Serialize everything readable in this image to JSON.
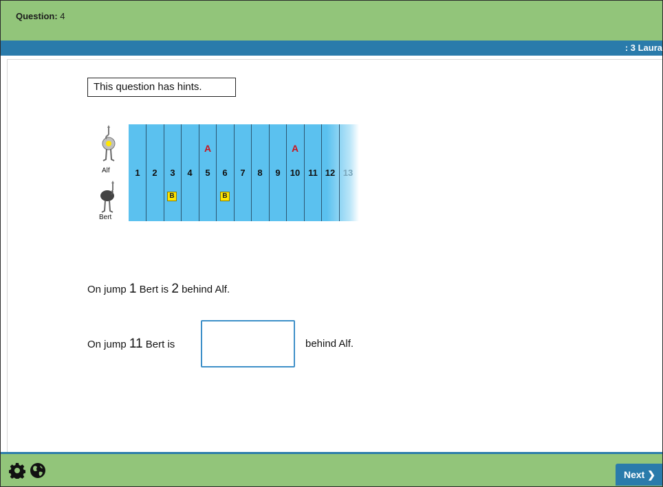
{
  "header": {
    "question_label": "Question:",
    "question_number": "4"
  },
  "user_bar": {
    "user_text": ": 3 Laura"
  },
  "hint": {
    "text": "This question has hints."
  },
  "illustration": {
    "alf_label": "Alf",
    "bert_label": "Bert",
    "jump_numbers": [
      "1",
      "2",
      "3",
      "4",
      "5",
      "6",
      "7",
      "8",
      "9",
      "10",
      "11",
      "12",
      "13"
    ],
    "alf_marker": "A",
    "alf_jumps": [
      "5",
      "10"
    ],
    "bert_marker": "B",
    "bert_jumps": [
      "3",
      "6"
    ]
  },
  "sentence1": {
    "prefix": "On jump",
    "jump": "1",
    "middle": "Bert is",
    "distance": "2",
    "suffix": "behind Alf."
  },
  "sentence2": {
    "prefix": "On jump",
    "jump": "11",
    "middle": "Bert is",
    "answer_value": "",
    "suffix": "behind Alf."
  },
  "footer": {
    "settings_icon": "gear-icon",
    "language_icon": "globe-icon",
    "next_label": "Next"
  },
  "colors": {
    "top_bar_green": "#92c57a",
    "accent_blue": "#2a7bab",
    "track_blue": "#5bc1ef",
    "alf_marker_red": "#c9141e",
    "bert_marker_yellow": "#ffe600"
  }
}
